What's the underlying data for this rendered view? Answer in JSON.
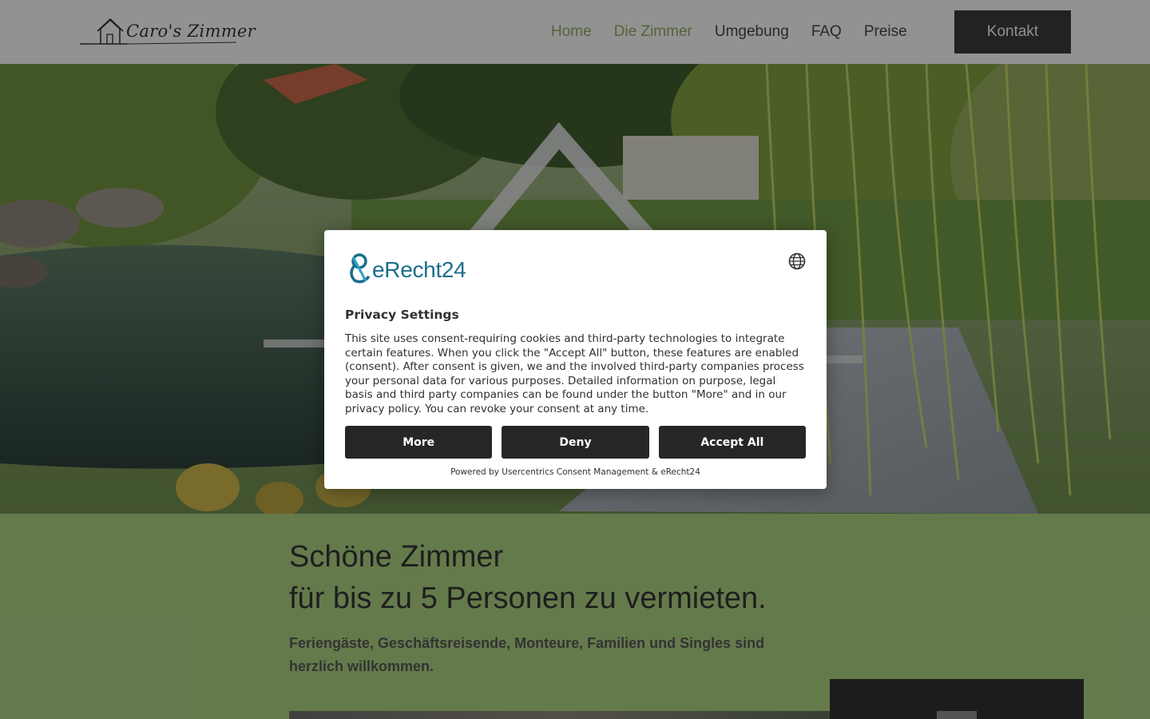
{
  "header": {
    "logo_text": "Caro's Zimmer",
    "nav": [
      {
        "label": "Home",
        "active": true
      },
      {
        "label": "Die Zimmer",
        "active": true
      },
      {
        "label": "Umgebung",
        "active": false
      },
      {
        "label": "FAQ",
        "active": false
      },
      {
        "label": "Preise",
        "active": false
      }
    ],
    "cta_label": "Kontakt"
  },
  "content": {
    "headline_line1": "Schöne Zimmer",
    "headline_line2": "für bis zu 5 Personen zu vermieten.",
    "subline": "Feriengäste, Geschäftsreisende, Monteure, Familien und Singles sind herzlich willkommen."
  },
  "consent": {
    "brand": "eRecht24",
    "title": "Privacy Settings",
    "body": "This site uses consent-requiring cookies and third-party technologies to integrate certain features. When you click the \"Accept All\" button, these features are enabled (consent). After consent is given, we and the involved third-party companies process your personal data for various purposes. Detailed information on purpose, legal basis and third party companies can be found under the button \"More\" and in our privacy policy. You can revoke your consent at any time.",
    "buttons": {
      "more": "More",
      "deny": "Deny",
      "accept": "Accept All"
    },
    "powered_by": "Powered by Usercentrics Consent Management & eRecht24"
  },
  "colors": {
    "accent_green": "#8aa65f",
    "brand_teal": "#1c6d8c",
    "button_dark": "#262626"
  }
}
